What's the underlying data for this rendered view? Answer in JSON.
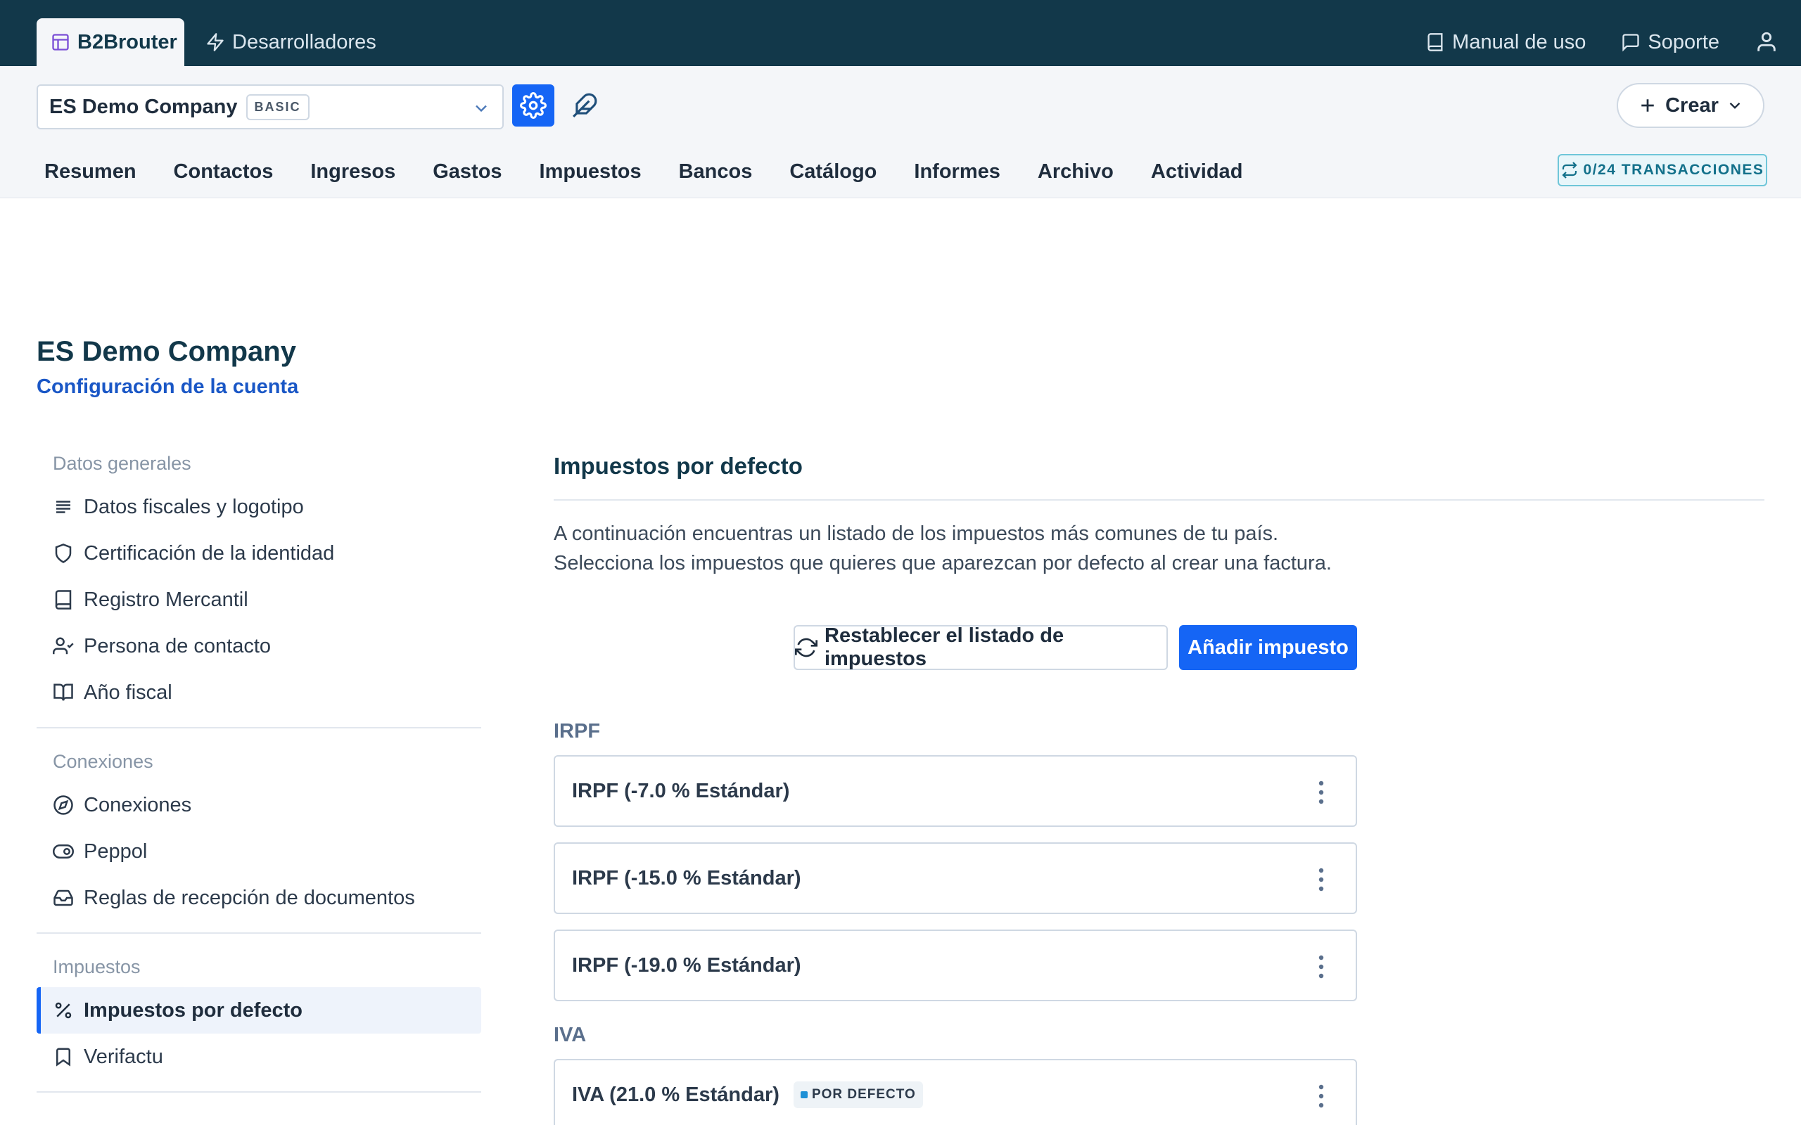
{
  "app": {
    "brand": "B2Brouter",
    "developers_tab": "Desarrolladores",
    "manual": "Manual de uso",
    "support": "Soporte"
  },
  "header": {
    "company": "ES Demo Company",
    "plan": "BASIC",
    "create_label": "Crear",
    "transactions": "0/24 TRANSACCIONES",
    "nav": [
      "Resumen",
      "Contactos",
      "Ingresos",
      "Gastos",
      "Impuestos",
      "Bancos",
      "Catálogo",
      "Informes",
      "Archivo",
      "Actividad"
    ]
  },
  "page": {
    "title": "ES Demo Company",
    "subtitle": "Configuración de la cuenta"
  },
  "sidebar": {
    "sections": [
      {
        "title": "Datos generales",
        "items": [
          {
            "label": "Datos fiscales y logotipo",
            "icon": "align-left-icon"
          },
          {
            "label": "Certificación de la identidad",
            "icon": "shield-icon"
          },
          {
            "label": "Registro Mercantil",
            "icon": "book-icon"
          },
          {
            "label": "Persona de contacto",
            "icon": "user-check-icon"
          },
          {
            "label": "Año fiscal",
            "icon": "book-open-icon"
          }
        ]
      },
      {
        "title": "Conexiones",
        "items": [
          {
            "label": "Conexiones",
            "icon": "compass-icon"
          },
          {
            "label": "Peppol",
            "icon": "toggle-icon"
          },
          {
            "label": "Reglas de recepción de documentos",
            "icon": "inbox-icon"
          }
        ]
      },
      {
        "title": "Impuestos",
        "items": [
          {
            "label": "Impuestos por defecto",
            "icon": "percent-icon",
            "active": true
          },
          {
            "label": "Verifactu",
            "icon": "bookmark-icon"
          }
        ]
      }
    ]
  },
  "main": {
    "title": "Impuestos por defecto",
    "desc_line1": "A continuación encuentras un listado de los impuestos más comunes de tu país.",
    "desc_line2": "Selecciona los impuestos que quieres que aparezcan por defecto al crear una factura.",
    "reset_label": "Restablecer el listado de impuestos",
    "add_label": "Añadir impuesto",
    "groups": [
      {
        "label": "IRPF",
        "taxes": [
          {
            "name": "IRPF (-7.0 % Estándar)"
          },
          {
            "name": "IRPF (-15.0 % Estándar)"
          },
          {
            "name": "IRPF (-19.0 % Estándar)"
          }
        ]
      },
      {
        "label": "IVA",
        "taxes": [
          {
            "name": "IVA (21.0 % Estándar)",
            "badge": "POR DEFECTO"
          }
        ]
      }
    ]
  },
  "colors": {
    "topbar": "#12384a",
    "accent": "#1565f5",
    "link": "#1a57c6"
  }
}
